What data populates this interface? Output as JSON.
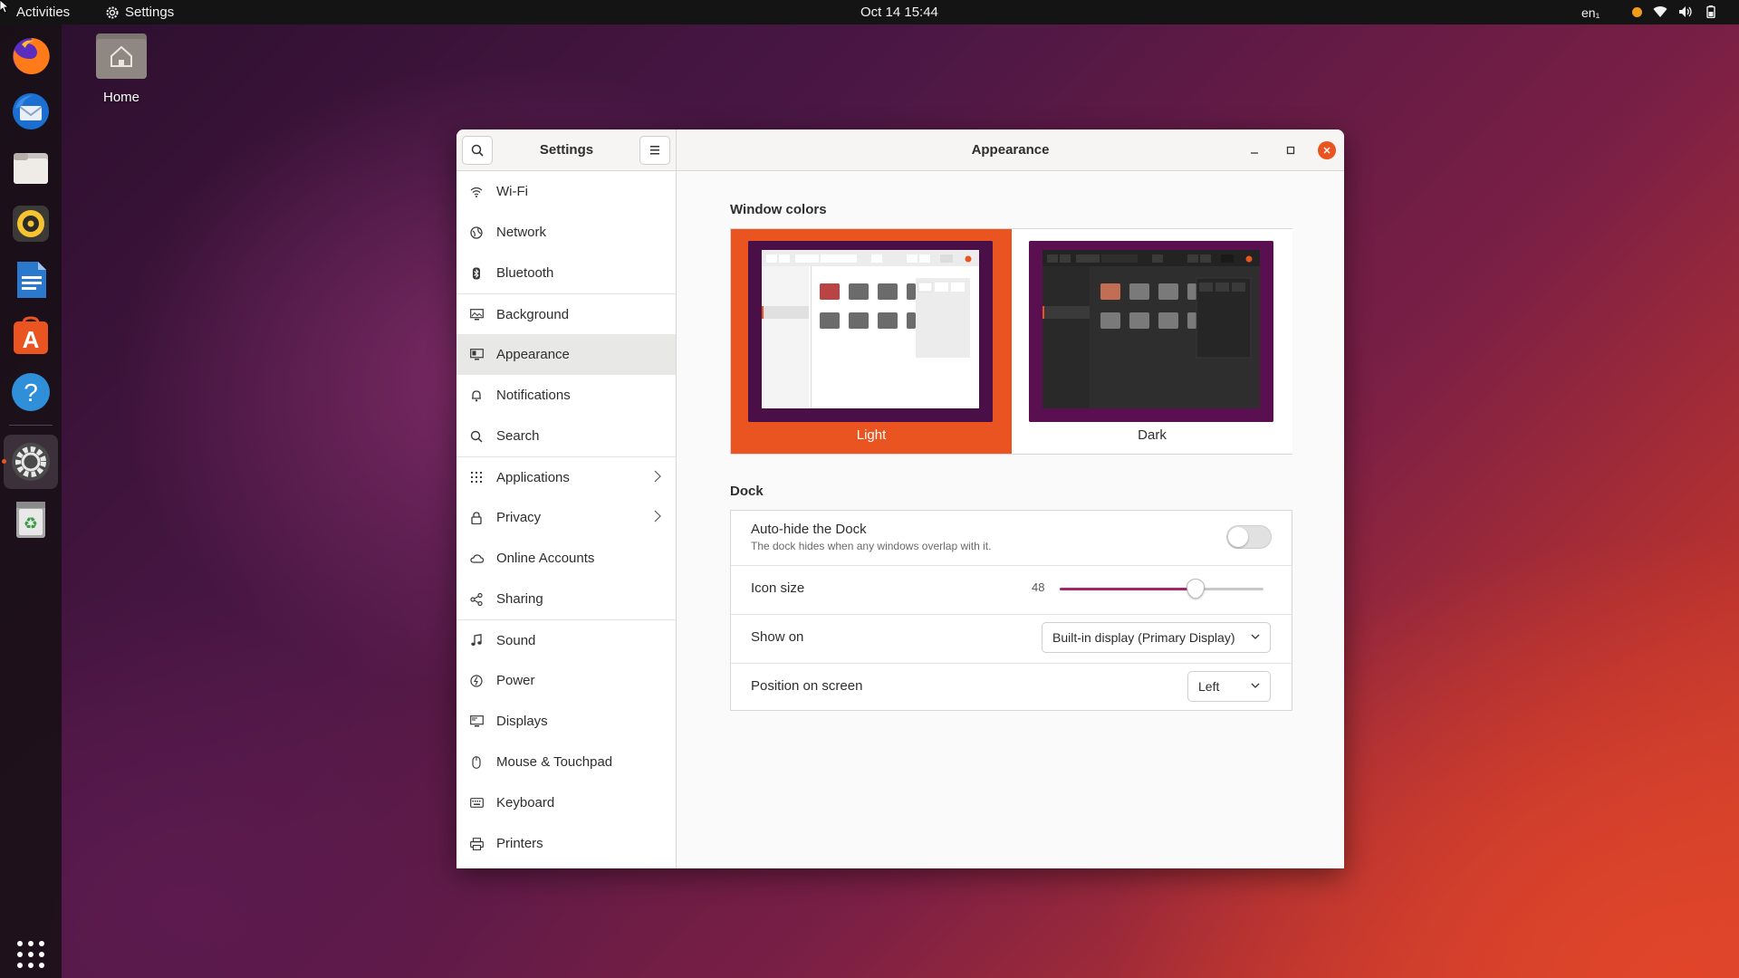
{
  "topbar": {
    "activities": "Activities",
    "app_name": "Settings",
    "clock": "Oct 14  15:44",
    "lang": "en₁"
  },
  "desktop": {
    "home_label": "Home"
  },
  "dock": {
    "apps": [
      "firefox-icon",
      "thunderbird-icon",
      "files-icon",
      "rhythmbox-icon",
      "libreoffice-writer-icon",
      "ubuntu-software-icon",
      "help-icon",
      "settings-icon",
      "trash-icon"
    ],
    "show_apps": "show-applications-icon"
  },
  "sidebar": {
    "title": "Settings",
    "items": [
      {
        "label": "Wi-Fi",
        "icon": "wifi-icon"
      },
      {
        "label": "Network",
        "icon": "network-icon"
      },
      {
        "label": "Bluetooth",
        "icon": "bluetooth-icon"
      },
      {
        "label": "Background",
        "icon": "background-icon"
      },
      {
        "label": "Appearance",
        "icon": "appearance-icon"
      },
      {
        "label": "Notifications",
        "icon": "bell-icon"
      },
      {
        "label": "Search",
        "icon": "search-icon"
      },
      {
        "label": "Applications",
        "icon": "grid-icon"
      },
      {
        "label": "Privacy",
        "icon": "lock-icon"
      },
      {
        "label": "Online Accounts",
        "icon": "cloud-icon"
      },
      {
        "label": "Sharing",
        "icon": "share-icon"
      },
      {
        "label": "Sound",
        "icon": "music-note-icon"
      },
      {
        "label": "Power",
        "icon": "power-icon"
      },
      {
        "label": "Displays",
        "icon": "display-icon"
      },
      {
        "label": "Mouse & Touchpad",
        "icon": "mouse-icon"
      },
      {
        "label": "Keyboard",
        "icon": "keyboard-icon"
      },
      {
        "label": "Printers",
        "icon": "printer-icon"
      }
    ],
    "selected": "Appearance"
  },
  "main": {
    "title": "Appearance",
    "window_colors": {
      "heading": "Window colors",
      "options": [
        "Light",
        "Dark"
      ],
      "selected": "Light"
    },
    "dock": {
      "heading": "Dock",
      "autohide_title": "Auto-hide the Dock",
      "autohide_sub": "The dock hides when any windows overlap with it.",
      "autohide_on": false,
      "icon_size_label": "Icon size",
      "icon_size_value": "48",
      "icon_size_min": 16,
      "icon_size_max": 64,
      "show_on_label": "Show on",
      "show_on_value": "Built-in display (Primary Display)",
      "position_label": "Position on screen",
      "position_value": "Left"
    }
  },
  "colors": {
    "accent": "#e95420",
    "slider": "#a3256b"
  }
}
